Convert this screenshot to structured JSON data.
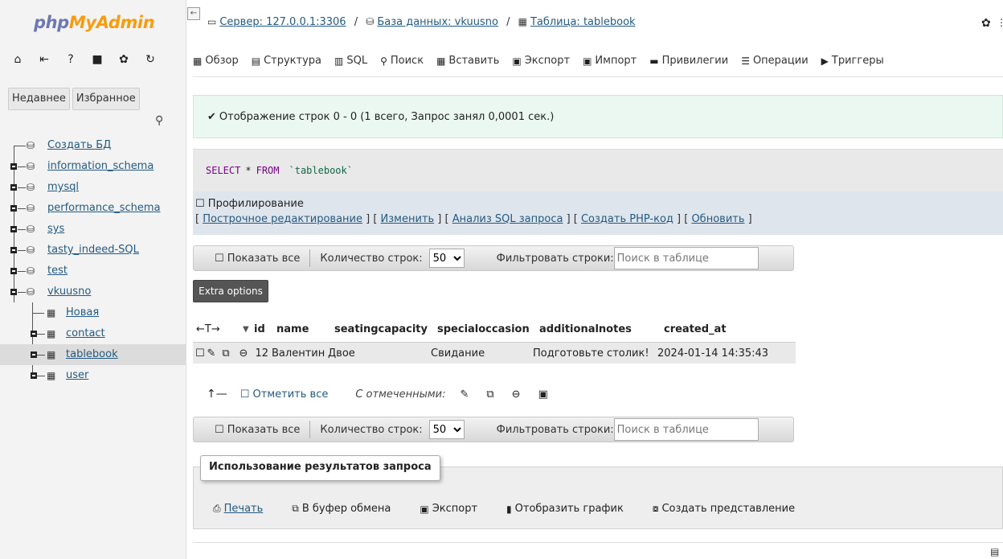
{
  "app": {
    "logo_part1": "php",
    "logo_part2": "MyAdmin"
  },
  "sidebar": {
    "nav_icons": [
      "home-icon",
      "logout-icon",
      "help-icon",
      "docs-icon",
      "settings-icon",
      "reload-icon"
    ],
    "tabs": {
      "recent": "Недавнее",
      "favorites": "Избранное"
    },
    "tree": [
      {
        "label": "Создать БД"
      },
      {
        "label": "information_schema"
      },
      {
        "label": "mysql"
      },
      {
        "label": "performance_schema"
      },
      {
        "label": "sys"
      },
      {
        "label": "tasty_indeed-SQL"
      },
      {
        "label": "test"
      },
      {
        "label": "vkuusno"
      },
      {
        "label": "Новая"
      },
      {
        "label": "contact"
      },
      {
        "label": "tablebook"
      },
      {
        "label": "user"
      }
    ]
  },
  "header": {
    "server": "Сервер: 127.0.0.1:3306",
    "database": "База данных: vkuusno",
    "table": "Таблица: tablebook",
    "separator": "/"
  },
  "menu": {
    "browse": "Обзор",
    "structure": "Структура",
    "sql": "SQL",
    "search": "Поиск",
    "insert": "Вставить",
    "export": "Экспорт",
    "import": "Импорт",
    "privileges": "Привилегии",
    "operations": "Операции",
    "triggers": "Триггеры"
  },
  "message": {
    "success": "Отображение строк 0 - 0 (1 всего, Запрос занял 0,0001 сек.)"
  },
  "query": {
    "select": "SELECT",
    "star": "*",
    "from": "FROM",
    "table": "`tablebook`"
  },
  "profiling": {
    "label": "Профилирование"
  },
  "query_links": {
    "inline_edit": "Построчное редактирование",
    "edit": "Изменить",
    "explain": "Анализ SQL запроса",
    "create_php": "Создать PHP-код",
    "refresh": "Обновить"
  },
  "navigation": {
    "show_all": "Показать все",
    "row_count_label": "Количество строк:",
    "row_count": "50",
    "filter_label": "Фильтровать строки:",
    "filter_placeholder": "Поиск в таблице"
  },
  "extra_options": "Extra options",
  "table": {
    "columns": [
      "id",
      "name",
      "seatingcapacity",
      "specialoccasion",
      "additionalnotes",
      "created_at"
    ],
    "rows": [
      [
        "12",
        "Валентин",
        "Двое",
        "Свидание",
        "Подготовьте столик!",
        "2024-01-14 14:35:43"
      ]
    ]
  },
  "bulk": {
    "check_all": "Отметить все",
    "with_selected": "С отмеченными:"
  },
  "query_results": {
    "legend": "Использование результатов запроса",
    "print": "Печать",
    "clipboard": "В буфер обмена",
    "export": "Экспорт",
    "chart": "Отобразить график",
    "create_view": "Создать представление"
  }
}
